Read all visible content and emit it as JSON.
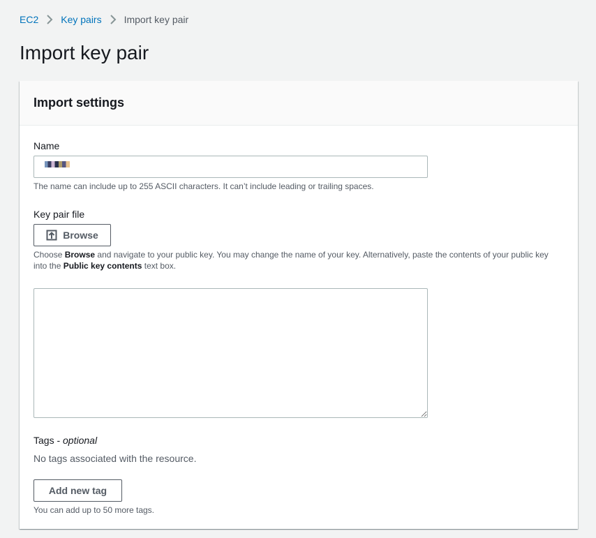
{
  "breadcrumb": {
    "items": [
      {
        "label": "EC2"
      },
      {
        "label": "Key pairs"
      },
      {
        "label": "Import key pair"
      }
    ]
  },
  "page": {
    "title": "Import key pair"
  },
  "panel": {
    "title": "Import settings",
    "name_field": {
      "label": "Name",
      "value": "",
      "hint": "The name can include up to 255 ASCII characters. It can’t include leading or trailing spaces."
    },
    "key_file": {
      "label": "Key pair file",
      "browse_label": "Browse",
      "hint_prefix": "Choose ",
      "hint_bold_1": "Browse",
      "hint_middle": " and navigate to your public key. You may change the name of your key. Alternatively, paste the contents of your public key into the ",
      "hint_bold_2": "Public key contents",
      "hint_suffix": " text box.",
      "textarea_value": ""
    },
    "tags": {
      "label": "Tags - ",
      "optional": "optional",
      "empty_text": "No tags associated with the resource.",
      "add_label": "Add new tag",
      "hint": "You can add up to 50 more tags."
    }
  },
  "colors": {
    "link": "#0073bb",
    "background": "#f2f3f3",
    "panel_header": "#fafafa",
    "text": "#16191f",
    "secondary_text": "#545b64"
  },
  "icons": {
    "breadcrumb_separator": "chevron-right-icon",
    "browse": "upload-icon"
  }
}
